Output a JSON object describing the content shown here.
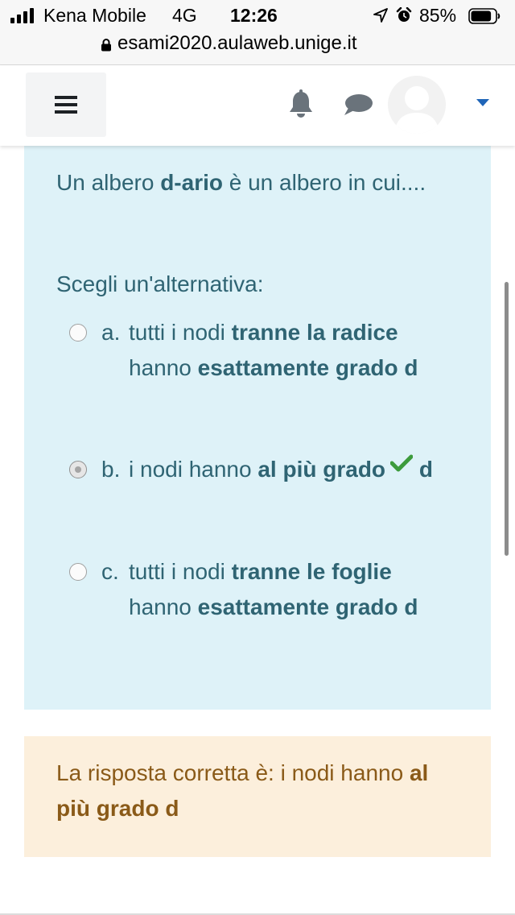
{
  "status_bar": {
    "carrier": "Kena Mobile",
    "network": "4G",
    "time": "12:26",
    "battery_percent": "85%",
    "battery_level": 0.85,
    "signal_bars": 4
  },
  "browser": {
    "url": "esami2020.aulaweb.unige.it"
  },
  "navbar": {
    "icons": [
      "menu-icon",
      "bell-icon",
      "chat-icon",
      "avatar",
      "caret-down-icon"
    ]
  },
  "question": {
    "text_before": "Un albero ",
    "text_bold": "d-ario",
    "text_after": " è un albero in cui....",
    "prompt": "Scegli un'alternativa:",
    "options": [
      {
        "letter": "a.",
        "parts": [
          {
            "t": "tutti i nodi ",
            "b": false
          },
          {
            "t": "tranne la radice",
            "b": true
          },
          {
            "t": " hanno ",
            "b": false
          },
          {
            "t": "esattamente grado d",
            "b": true
          }
        ],
        "selected": false,
        "correct": false
      },
      {
        "letter": "b.",
        "parts": [
          {
            "t": "i nodi hanno ",
            "b": false
          },
          {
            "t": "al più grado",
            "b": true
          },
          {
            "t": " ",
            "b": false
          },
          {
            "t": "d",
            "b": true
          }
        ],
        "selected": true,
        "correct": true
      },
      {
        "letter": "c.",
        "parts": [
          {
            "t": "tutti i nodi ",
            "b": false
          },
          {
            "t": "tranne le foglie",
            "b": true
          },
          {
            "t": " hanno ",
            "b": false
          },
          {
            "t": "esattamente grado d",
            "b": true
          }
        ],
        "selected": false,
        "correct": false
      }
    ]
  },
  "right_answer": {
    "prefix": "La risposta corretta è: i nodi hanno ",
    "bold": "al più grado d"
  },
  "colors": {
    "question_bg": "#def2f8",
    "question_text": "#2f6473",
    "answer_bg": "#fcefdc",
    "answer_text": "#8a5a18",
    "check": "#3c9b3c",
    "accent": "#1f65b8"
  }
}
